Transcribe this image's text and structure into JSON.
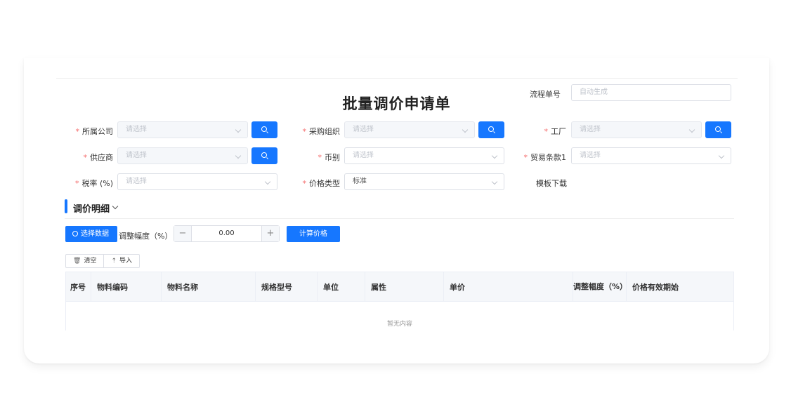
{
  "title": "批量调价申请单",
  "process_no": {
    "label": "流程单号",
    "placeholder": "自动生成"
  },
  "fields": {
    "company": {
      "label": "所属公司",
      "placeholder": "请选择"
    },
    "purchase_org": {
      "label": "采购组织",
      "placeholder": "请选择"
    },
    "factory": {
      "label": "工厂",
      "placeholder": "请选择"
    },
    "supplier": {
      "label": "供应商",
      "placeholder": "请选择"
    },
    "currency": {
      "label": "币别",
      "placeholder": "请选择"
    },
    "trade_terms": {
      "label": "贸易条款1",
      "placeholder": "请选择"
    },
    "tax_rate": {
      "label": "税率 (%)",
      "placeholder": "请选择"
    },
    "price_type": {
      "label": "价格类型",
      "value": "标准"
    },
    "template_download": "模板下载"
  },
  "section": {
    "title": "调价明细"
  },
  "toolbar": {
    "select_data": "选择数据",
    "adjust_label": "调整幅度（%）",
    "stepper_value": "0.00",
    "minus": "−",
    "plus": "+",
    "calc_price": "计算价格",
    "clear": "清空",
    "import": "导入"
  },
  "table": {
    "columns": [
      "序号",
      "物料编码",
      "物料名称",
      "规格型号",
      "单位",
      "属性",
      "单价",
      "调整幅度（%）",
      "价格有效期始"
    ],
    "empty_text": "暂无内容"
  },
  "colors": {
    "primary": "#1677ff",
    "required": "#f56c6c"
  }
}
